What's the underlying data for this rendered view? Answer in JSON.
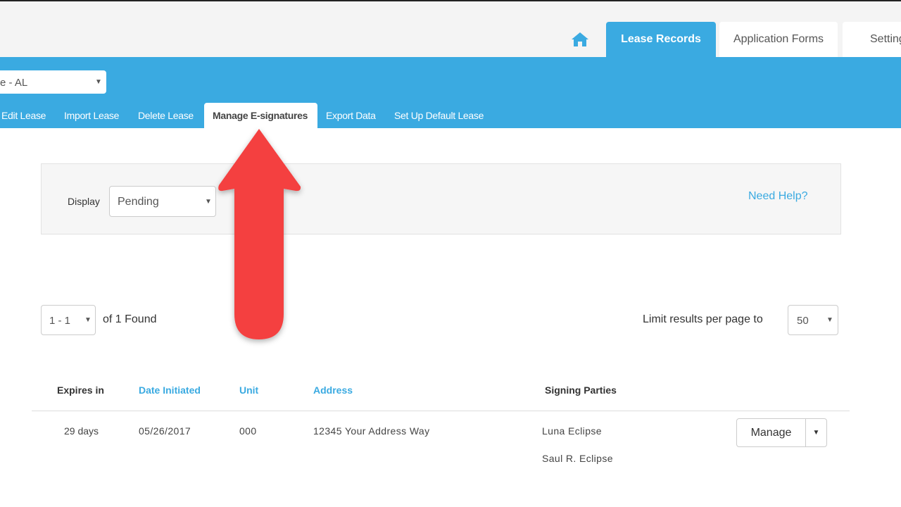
{
  "top_nav": {
    "home_icon": "home-icon",
    "tabs": [
      {
        "label": "Lease Records",
        "active": true
      },
      {
        "label": "Application Forms"
      },
      {
        "label": "Settings"
      }
    ]
  },
  "property_select": {
    "value": "e - AL"
  },
  "sub_nav": {
    "tabs": [
      {
        "label": "Edit Lease"
      },
      {
        "label": "Import Lease"
      },
      {
        "label": "Delete Lease"
      },
      {
        "label": "Manage E-signatures",
        "active": true
      },
      {
        "label": "Export Data"
      },
      {
        "label": "Set Up Default Lease"
      }
    ]
  },
  "filter": {
    "display_label": "Display",
    "display_value": "Pending",
    "help_link": "Need Help?"
  },
  "pagination": {
    "range_value": "1 - 1",
    "found_text": "of 1 Found",
    "limit_label": "Limit results per page to",
    "limit_value": "50"
  },
  "table": {
    "columns": [
      "Expires in",
      "Date Initiated",
      "Unit",
      "Address",
      "Signing Parties"
    ],
    "rows": [
      {
        "expires": "29 days",
        "date": "05/26/2017",
        "unit": "000",
        "address": "12345 Your Address Way",
        "parties": [
          "Luna Eclipse",
          "Saul R. Eclipse"
        ],
        "action": "Manage"
      }
    ]
  },
  "colors": {
    "accent": "#3aaae1",
    "arrow": "#f44040"
  }
}
